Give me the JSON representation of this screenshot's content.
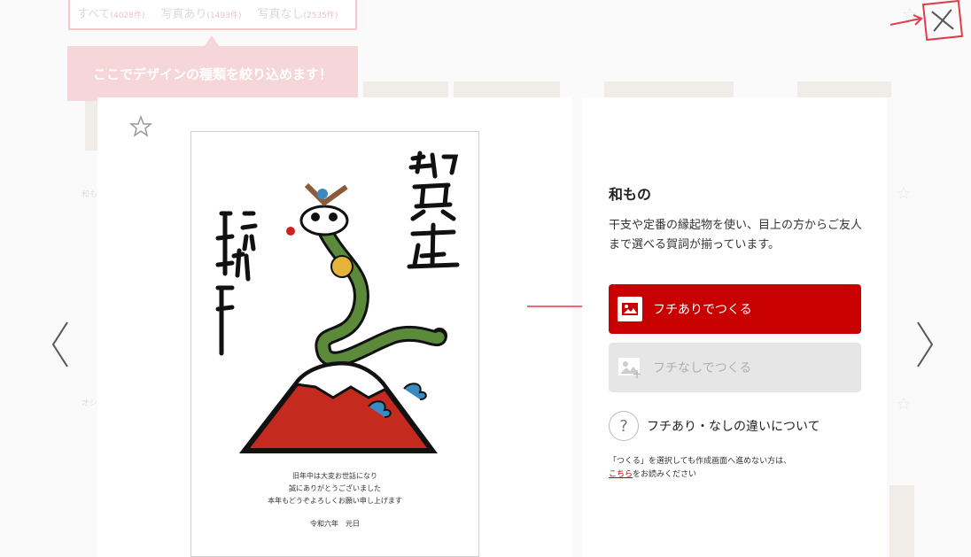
{
  "background": {
    "filter_tabs": [
      {
        "label": "すべて",
        "count": "(4028件)"
      },
      {
        "label": "写真あり",
        "count": "(1493件)"
      },
      {
        "label": "写真なし",
        "count": "(2535件)"
      }
    ],
    "tooltip": "ここでデザインの種類を絞り込めます！",
    "category_label_1": "和もの",
    "category_label_2": "オシ"
  },
  "modal": {
    "close_icon": "close-x-icon",
    "prev_icon": "chevron-left-icon",
    "next_icon": "chevron-right-icon",
    "favorite_icon": "star-outline-icon",
    "preview": {
      "greeting_lines": [
        "旧年中は大変お世話になり",
        "誠にありがとうございました",
        "本年もどうぞよろしくお願い申し上げます"
      ],
      "date": "令和六年　元日"
    },
    "info": {
      "title": "和もの",
      "description": "干支や定番の縁起物を使い、目上の方からご友人まで選べる賀詞が揃っています。",
      "btn_with_border": "フチありでつくる",
      "btn_without_border": "フチなしでつくる",
      "difference_link": "フチあり・なしの違いについて",
      "note_prefix": "「つくる」を選択しても作成画面へ進めない方は、",
      "note_link": "こちら",
      "note_suffix": "をお読みください"
    },
    "colors": {
      "accent": "#c80000",
      "annotation": "#e23b4a"
    }
  }
}
